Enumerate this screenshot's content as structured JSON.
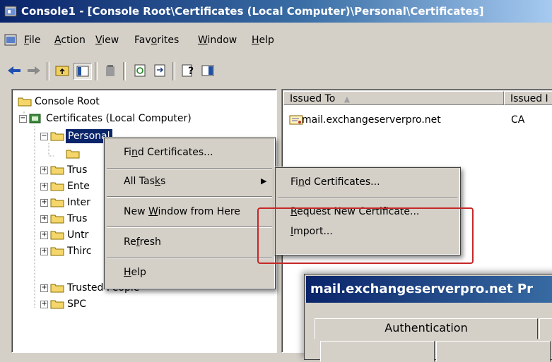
{
  "window": {
    "title": "Console1 - [Console Root\\Certificates (Local Computer)\\Personal\\Certificates]"
  },
  "menubar": {
    "items": [
      {
        "pre": "",
        "acc": "F",
        "post": "ile"
      },
      {
        "pre": "",
        "acc": "A",
        "post": "ction"
      },
      {
        "pre": "",
        "acc": "V",
        "post": "iew"
      },
      {
        "pre": "Fav",
        "acc": "o",
        "post": "rites"
      },
      {
        "pre": "",
        "acc": "W",
        "post": "indow"
      },
      {
        "pre": "",
        "acc": "H",
        "post": "elp"
      }
    ]
  },
  "toolbar": {
    "icons": [
      "back-arrow-icon",
      "forward-arrow-icon",
      "up-folder-icon",
      "show-hide-tree-icon",
      "delete-icon",
      "refresh-icon",
      "export-list-icon",
      "help-icon",
      "action-pane-icon"
    ]
  },
  "tree": {
    "root": "Console Root",
    "certificates": "Certificates (Local Computer)",
    "personal": "Personal",
    "children": [
      {
        "label": "Trus"
      },
      {
        "label": "Ente"
      },
      {
        "label": "Inter"
      },
      {
        "label": "Trus"
      },
      {
        "label": "Untr"
      },
      {
        "label": "Thirc"
      },
      {
        "label": "Trusted People"
      },
      {
        "label": "SPC"
      }
    ]
  },
  "list": {
    "columns": [
      "Issued To",
      "Issued I"
    ],
    "rows": [
      {
        "issued_to": "mail.exchangeserverpro.net",
        "issued_by": "CA"
      }
    ]
  },
  "context_menu": {
    "find_certificates": {
      "pre": "Fi",
      "acc": "n",
      "post": "d Certificates..."
    },
    "all_tasks": {
      "pre": "All Tas",
      "acc": "k",
      "post": "s"
    },
    "new_window": {
      "pre": "New ",
      "acc": "W",
      "post": "indow from Here"
    },
    "refresh": {
      "pre": "Re",
      "acc": "f",
      "post": "resh"
    },
    "help": {
      "pre": "",
      "acc": "H",
      "post": "elp"
    }
  },
  "submenu": {
    "find_certificates": {
      "pre": "Fi",
      "acc": "n",
      "post": "d Certificates..."
    },
    "request_new": {
      "pre": "",
      "acc": "R",
      "post": "equest New Certificate..."
    },
    "import": {
      "pre": "",
      "acc": "I",
      "post": "mport..."
    }
  },
  "properties_dialog": {
    "title": "mail.exchangeserverpro.net Pr",
    "tabs": [
      "Authentication"
    ]
  },
  "colors": {
    "highlight_box": "#c62828",
    "title_blue": "#0a246a"
  }
}
